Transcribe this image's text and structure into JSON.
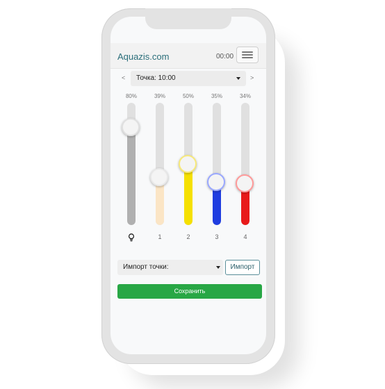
{
  "header": {
    "brand": "Aquazis.com",
    "time": "00:00"
  },
  "point": {
    "prev": "<",
    "next": ">",
    "selected": "Точка: 10:00"
  },
  "sliders": [
    {
      "label": "",
      "label_icon": "lightbulb-icon",
      "percent_text": "80%",
      "level": 0.8,
      "fill_color": "#b0b0b0",
      "thumb_ring": "#e0e0e0"
    },
    {
      "label": "1",
      "percent_text": "39%",
      "level": 0.39,
      "fill_color": "#fbe5c5",
      "thumb_ring": "#e8e8e8"
    },
    {
      "label": "2",
      "percent_text": "50%",
      "level": 0.5,
      "fill_color": "#f5e000",
      "thumb_ring": "#f7e97a"
    },
    {
      "label": "3",
      "percent_text": "35%",
      "level": 0.35,
      "fill_color": "#1f3de0",
      "thumb_ring": "#9aa8ff"
    },
    {
      "label": "4",
      "percent_text": "34%",
      "level": 0.34,
      "fill_color": "#e81a1a",
      "thumb_ring": "#ff9a9a"
    }
  ],
  "import": {
    "select_text": "Импорт точки:",
    "button_label": "Импорт"
  },
  "save": {
    "label": "Сохранить"
  }
}
